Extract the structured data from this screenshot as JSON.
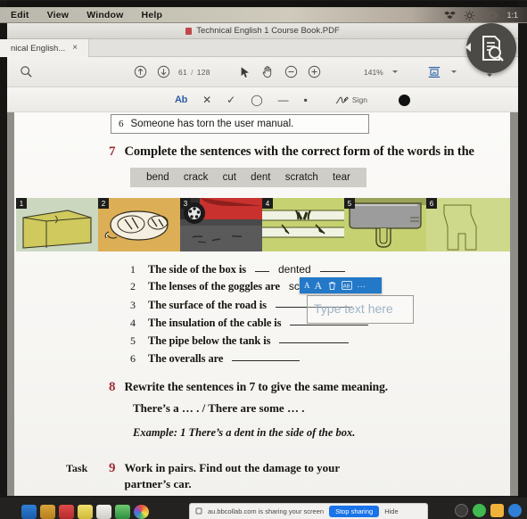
{
  "menubar": {
    "items": [
      {
        "label": "Edit"
      },
      {
        "label": "View"
      },
      {
        "label": "Window"
      },
      {
        "label": "Help"
      }
    ],
    "status_items": [
      {
        "name": "dropbox-icon"
      },
      {
        "name": "gear-icon"
      },
      {
        "name": "battery-icon"
      },
      {
        "name": "clock-text",
        "label": "1:1"
      }
    ]
  },
  "titlebar": {
    "title": "Technical English 1 Course Book.PDF"
  },
  "tab": {
    "label": "nical English...",
    "close": "×"
  },
  "toolbar": {
    "search_icon": "search-icon",
    "prev_page_icon": "page-up-icon",
    "next_page_icon": "page-down-icon",
    "current_page": "61",
    "page_separator": "/",
    "total_pages": "128",
    "select_tool_icon": "pointer-icon",
    "pan_tool_icon": "hand-icon",
    "zoom_out_icon": "zoom-out-icon",
    "zoom_in_icon": "zoom-in-icon",
    "zoom_value": "141%",
    "view_mode_icon": "page-fit-icon",
    "share_icon": "export-icon"
  },
  "annotation_toolbar": {
    "tools": [
      {
        "name": "text-tool",
        "glyph": "Ab"
      },
      {
        "name": "cross-tool",
        "glyph": "✕"
      },
      {
        "name": "check-tool",
        "glyph": "✓"
      },
      {
        "name": "oval-tool",
        "glyph": "◯"
      },
      {
        "name": "line-tool",
        "glyph": "—"
      },
      {
        "name": "dot-tool",
        "glyph": "▪"
      }
    ],
    "sign_label": "Sign",
    "ink_color": "#111111"
  },
  "document": {
    "sentence6": {
      "number": "6",
      "text": "Someone has torn the user manual."
    },
    "exercise7": {
      "number": "7",
      "heading": "Complete the sentences with the correct form of the words in the",
      "wordbank": [
        "bend",
        "crack",
        "cut",
        "dent",
        "scratch",
        "tear"
      ],
      "thumbnails": [
        {
          "badge": "1",
          "caption": "cardboard-box-illustration"
        },
        {
          "badge": "2",
          "caption": "safety-goggles-illustration"
        },
        {
          "badge": "3",
          "caption": "car-wheel-road-illustration"
        },
        {
          "badge": "4",
          "caption": "cable-insulation-illustration"
        },
        {
          "badge": "5",
          "caption": "tank-pipe-illustration"
        },
        {
          "badge": "6",
          "caption": "overalls-illustration"
        }
      ],
      "sentences": [
        {
          "number": "1",
          "text": "The side of the box is",
          "answer": "dented",
          "suffix": "."
        },
        {
          "number": "2",
          "text": "The lenses of the goggles are",
          "answer": "scratched",
          "suffix": "."
        },
        {
          "number": "3",
          "text": "The surface of the road is",
          "answer": "",
          "suffix": "."
        },
        {
          "number": "4",
          "text": "The insulation of the cable is",
          "answer": "",
          "suffix": "."
        },
        {
          "number": "5",
          "text": "The pipe below the tank is",
          "answer": "",
          "suffix": "."
        },
        {
          "number": "6",
          "text": "The overalls are",
          "answer": "",
          "suffix": "."
        }
      ]
    },
    "exercise8": {
      "number": "8",
      "heading": "Rewrite the sentences in 7 to give the same meaning.",
      "line2": "There’s a … . / There are some … .",
      "example": "Example: 1 There’s a dent in the side of the box."
    },
    "exercise9": {
      "task_label": "Task",
      "number": "9",
      "line1": "Work in pairs. Find out the damage to your",
      "line2": "partner’s car."
    }
  },
  "annotation_popup": {
    "decrease_font": "A",
    "increase_font": "A",
    "delete_icon": "trash-icon",
    "textbox_icon": "text-box-icon",
    "more_label": "…",
    "accent_color": "#2378c8"
  },
  "annotation_textbox": {
    "placeholder": "Type text here"
  },
  "sharing_bar": {
    "message": "au.bbcollab.com is sharing your screen",
    "stop_label": "Stop sharing",
    "hide_label": "Hide"
  },
  "fab": {
    "name": "document-search-overlay-button"
  }
}
